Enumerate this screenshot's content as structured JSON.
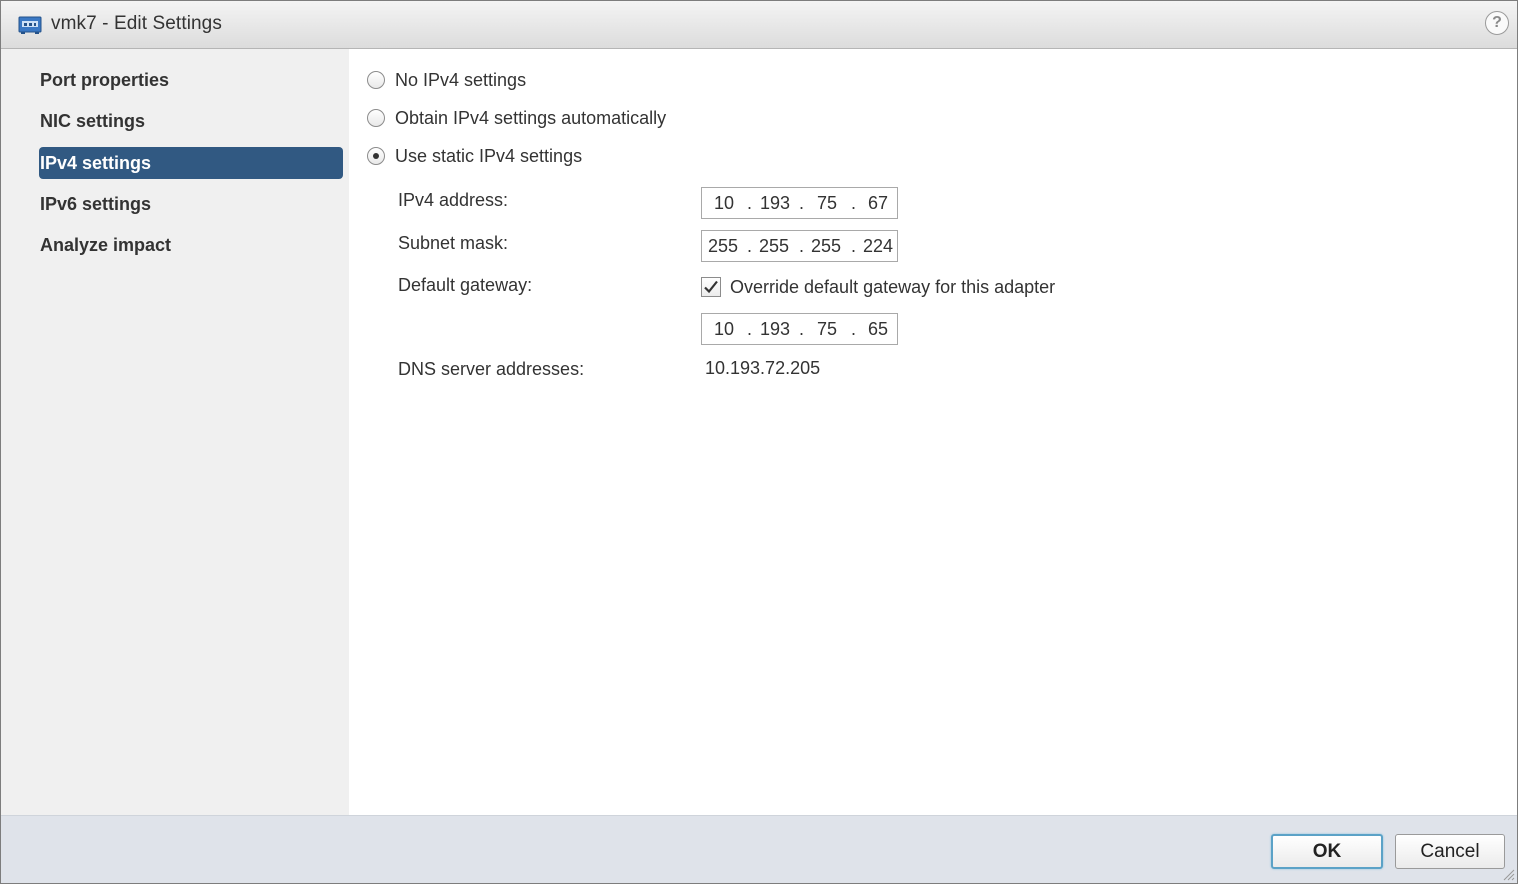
{
  "window": {
    "title": "vmk7 - Edit Settings",
    "help_label": "?"
  },
  "sidebar": {
    "items": [
      {
        "label": "Port properties",
        "selected": false
      },
      {
        "label": "NIC settings",
        "selected": false
      },
      {
        "label": "IPv4 settings",
        "selected": true
      },
      {
        "label": "IPv6 settings",
        "selected": false
      },
      {
        "label": "Analyze impact",
        "selected": false
      }
    ]
  },
  "ipv4": {
    "options": [
      {
        "label": "No IPv4 settings",
        "checked": false
      },
      {
        "label": "Obtain IPv4 settings automatically",
        "checked": false
      },
      {
        "label": "Use static IPv4 settings",
        "checked": true
      }
    ],
    "address_label": "IPv4 address:",
    "address": [
      "10",
      "193",
      "75",
      "67"
    ],
    "subnet_label": "Subnet mask:",
    "subnet": [
      "255",
      "255",
      "255",
      "224"
    ],
    "gateway_label": "Default gateway:",
    "override_label": "Override default gateway for this adapter",
    "override_checked": true,
    "gateway": [
      "10",
      "193",
      "75",
      "65"
    ],
    "dns_label": "DNS server addresses:",
    "dns_value": "10.193.72.205",
    "separator": "."
  },
  "footer": {
    "ok_label": "OK",
    "cancel_label": "Cancel"
  },
  "colors": {
    "selected_bg": "#315982",
    "footer_bg": "#dfe3ea",
    "ok_focus": "#5ba2c7"
  }
}
